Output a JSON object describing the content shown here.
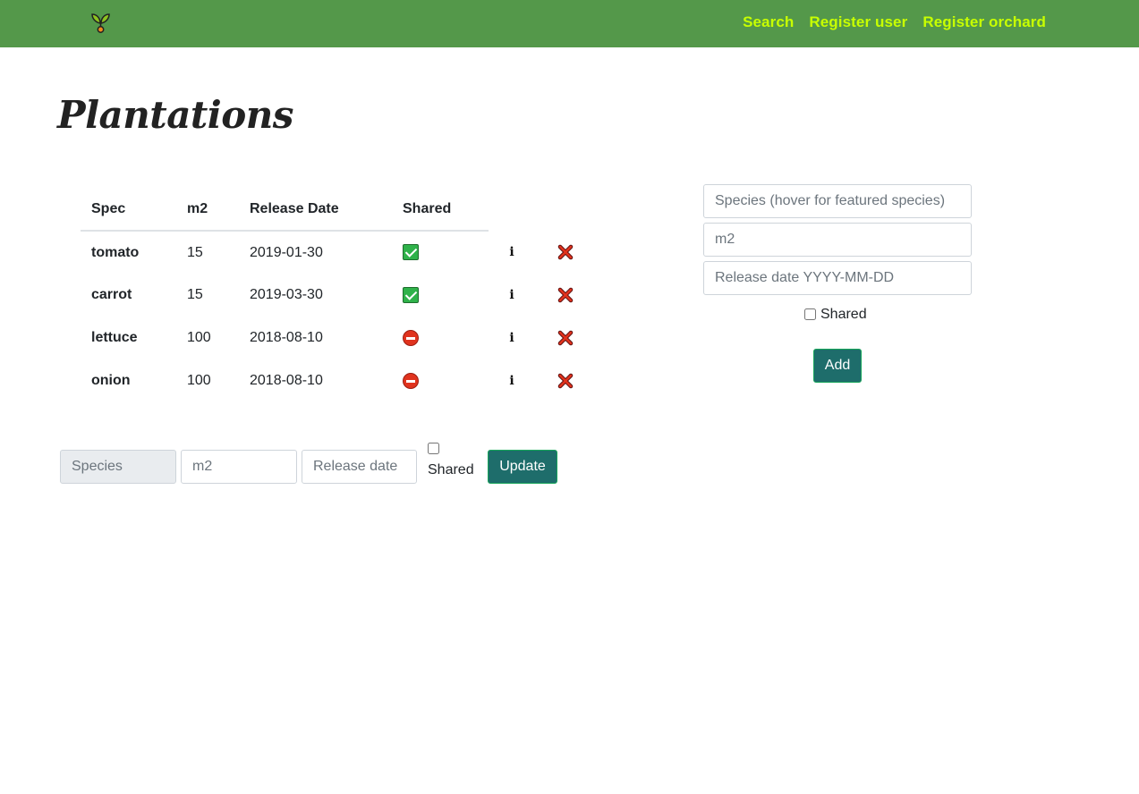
{
  "navbar": {
    "logo_icon": "sprout-icon",
    "links": [
      "Search",
      "Register user",
      "Register orchard"
    ],
    "background": "#54984a",
    "link_color": "#c8ff00"
  },
  "page_title": "Plantations",
  "table": {
    "headers": [
      "Spec",
      "m2",
      "Release Date",
      "Shared"
    ],
    "rows": [
      {
        "spec": "tomato",
        "m2": "15",
        "date": "2019-01-30",
        "shared": true
      },
      {
        "spec": "carrot",
        "m2": "15",
        "date": "2019-03-30",
        "shared": true
      },
      {
        "spec": "lettuce",
        "m2": "100",
        "date": "2018-08-10",
        "shared": false
      },
      {
        "spec": "onion",
        "m2": "100",
        "date": "2018-08-10",
        "shared": false
      }
    ],
    "shared_true_icon": "check-box-icon",
    "shared_false_icon": "no-entry-icon",
    "info_icon": "info-icon",
    "delete_icon": "cross-icon"
  },
  "update_form": {
    "species_placeholder": "Species",
    "m2_placeholder": "m2",
    "date_placeholder": "Release date",
    "shared_label": "Shared",
    "button_label": "Update"
  },
  "add_form": {
    "species_placeholder": "Species (hover for featured species)",
    "m2_placeholder": "m2",
    "date_placeholder": "Release date YYYY-MM-DD",
    "shared_label": "Shared",
    "button_label": "Add"
  },
  "button_color": "#1e6d6b"
}
